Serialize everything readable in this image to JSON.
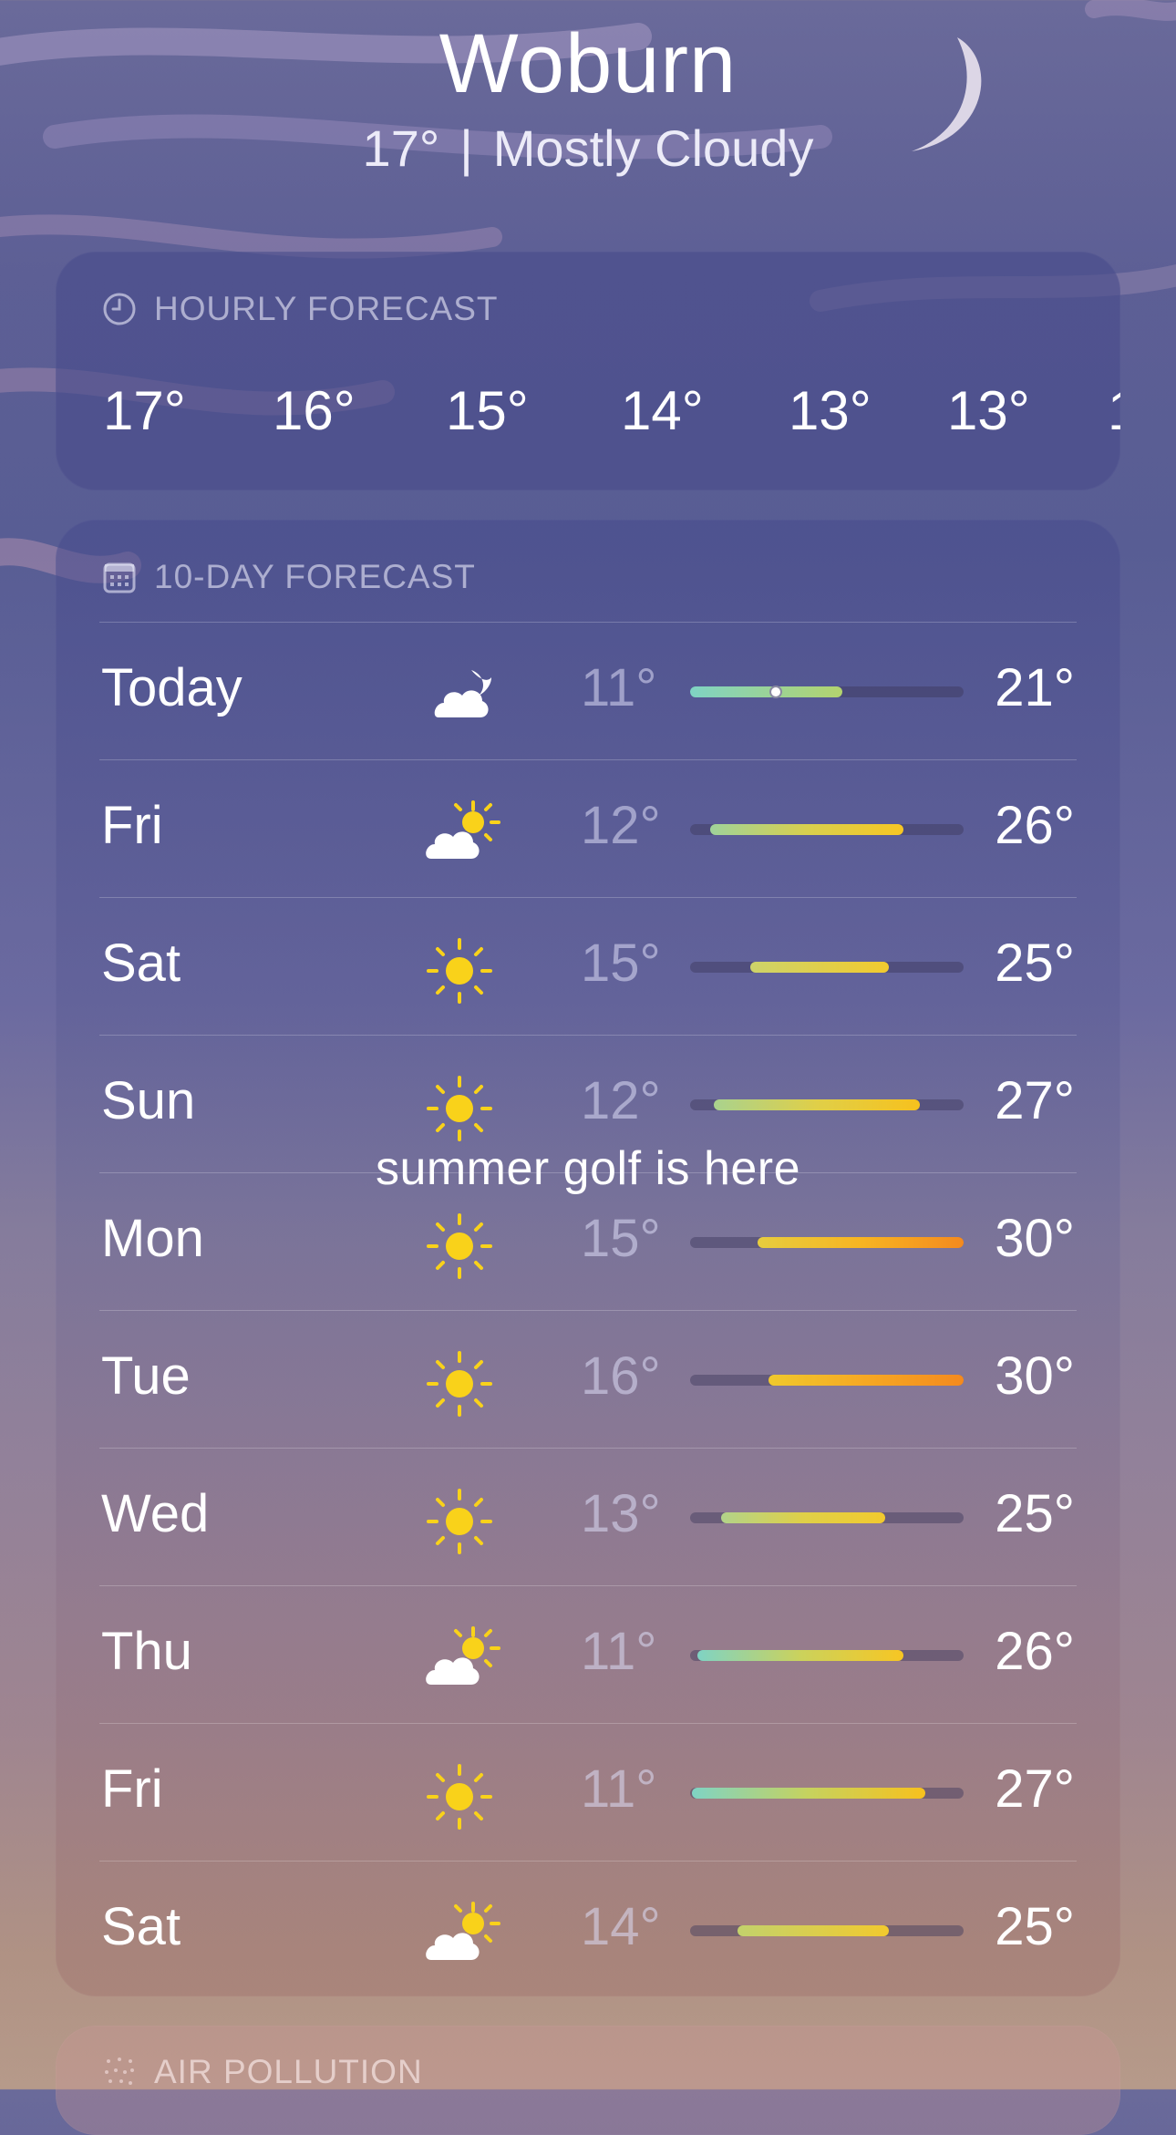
{
  "location": {
    "city": "Woburn",
    "current_temp": "17°",
    "separator": "|",
    "condition": "Mostly Cloudy"
  },
  "hourly": {
    "title": "HOURLY FORECAST",
    "icon": "clock-icon",
    "temps": [
      "17°",
      "16°",
      "15°",
      "14°",
      "13°",
      "13°",
      "1"
    ]
  },
  "daily": {
    "title": "10-DAY FORECAST",
    "icon": "calendar-icon",
    "rows": [
      {
        "day": "Today",
        "icon": "moon-cloud-icon",
        "low": "11°",
        "high": "21°"
      },
      {
        "day": "Fri",
        "icon": "partly-sunny-icon",
        "low": "12°",
        "high": "26°"
      },
      {
        "day": "Sat",
        "icon": "sun-icon",
        "low": "15°",
        "high": "25°"
      },
      {
        "day": "Sun",
        "icon": "sun-icon",
        "low": "12°",
        "high": "27°"
      },
      {
        "day": "Mon",
        "icon": "sun-icon",
        "low": "15°",
        "high": "30°"
      },
      {
        "day": "Tue",
        "icon": "sun-icon",
        "low": "16°",
        "high": "30°"
      },
      {
        "day": "Wed",
        "icon": "sun-icon",
        "low": "13°",
        "high": "25°"
      },
      {
        "day": "Thu",
        "icon": "partly-sunny-icon",
        "low": "11°",
        "high": "26°"
      },
      {
        "day": "Fri",
        "icon": "sun-icon",
        "low": "11°",
        "high": "27°"
      },
      {
        "day": "Sat",
        "icon": "partly-sunny-icon",
        "low": "14°",
        "high": "25°"
      }
    ]
  },
  "caption": "summer golf is here",
  "air_pollution": {
    "title": "AIR POLLUTION",
    "icon": "dots-grid-icon"
  },
  "colors": {
    "cool": "#7fd3c4",
    "mild": "#c7d26a",
    "warm": "#f7c623",
    "hot": "#f48a1e",
    "sun": "#f9d21a"
  }
}
